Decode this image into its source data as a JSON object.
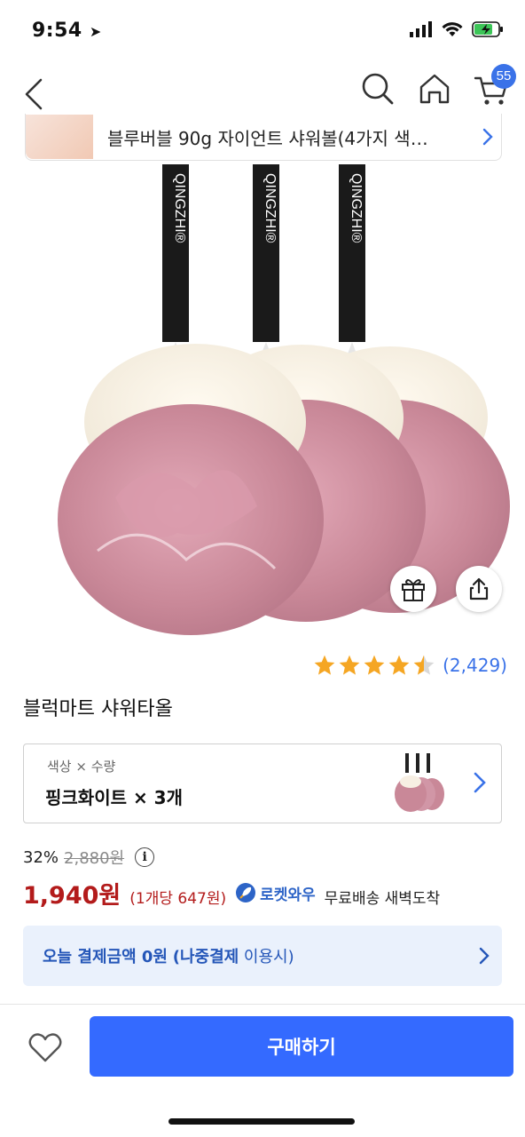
{
  "status_bar": {
    "time": "9:54"
  },
  "nav": {
    "cart_count": "55"
  },
  "recent_product": {
    "title": "블루버블 90g 자이언트 샤워볼(4가지 색…"
  },
  "product": {
    "title": "블럭마트 샤워타올",
    "rating": 4.5,
    "review_count": "(2,429)",
    "image_strap_text": "QINGZHI®"
  },
  "option": {
    "label": "색상 × 수량",
    "value": "핑크화이트 × 3개"
  },
  "price": {
    "discount": "32%",
    "original": "2,880원",
    "info_icon_label": "i",
    "current": "1,940원",
    "unit": "(1개당 647원)",
    "rocket_label": "로켓와우",
    "delivery": "무료배송 새벽도착"
  },
  "pay_later": {
    "part1": "오늘 결제금액 0원",
    "part2": "(나중결제",
    "part3": "이용시)"
  },
  "bottom": {
    "buy_label": "구매하기"
  },
  "colors": {
    "accent": "#346aff",
    "price_red": "#b31b1b",
    "link_blue": "#3a72e8",
    "star": "#f5a623"
  }
}
